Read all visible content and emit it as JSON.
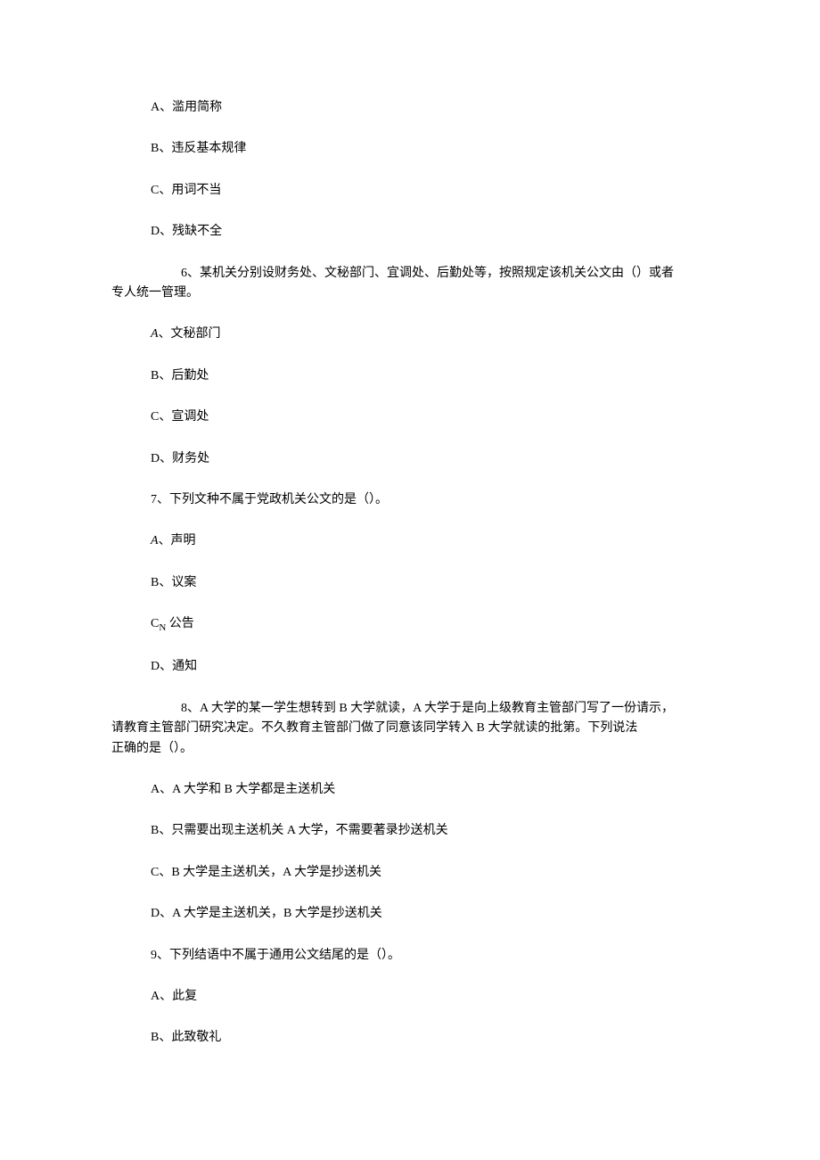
{
  "q5": {
    "optA": "A、滥用简称",
    "optB": "B、违反基本规律",
    "optC": "C、用词不当",
    "optD": "D、残缺不全"
  },
  "q6": {
    "stem_line1": "6、某机关分别设财务处、文秘部门、宜调处、后勤处等，按照规定该机关公文由（）或者",
    "stem_line2": "专人统一管理。",
    "optA_prefix": "A",
    "optA_rest": "、文秘部门",
    "optB": "B、后勤处",
    "optC": "C、宣调处",
    "optD": "D、财务处"
  },
  "q7": {
    "stem": "7、下列文种不属于党政机关公文的是（）。",
    "optA_prefix": "A",
    "optA_rest": "、声明",
    "optB": "B、议案",
    "optC_prefix": "C",
    "optC_sub": "N",
    "optC_rest": " 公告",
    "optD": "D、通知"
  },
  "q8": {
    "stem_line1": "8、A 大学的某一学生想转到 B 大学就读，A 大学于是向上级教育主管部门写了一份请示，",
    "stem_line2": "请教育主管部门研究决定。不久教育主管部门做了同意该同学转入 B 大学就读的批第。下列说法",
    "stem_line3": "正确的是（）。",
    "optA": "A、A 大学和 B 大学都是主送机关",
    "optB": "B、只需要出现主送机关 A 大学，不需要著录抄送机关",
    "optC": "C、B 大学是主送机关，A 大学是抄送机关",
    "optD": "D、A 大学是主送机关，B 大学是抄送机关"
  },
  "q9": {
    "stem": "9、下列结语中不属于通用公文结尾的是（）。",
    "optA": "A、此复",
    "optB": "B、此致敬礼"
  }
}
